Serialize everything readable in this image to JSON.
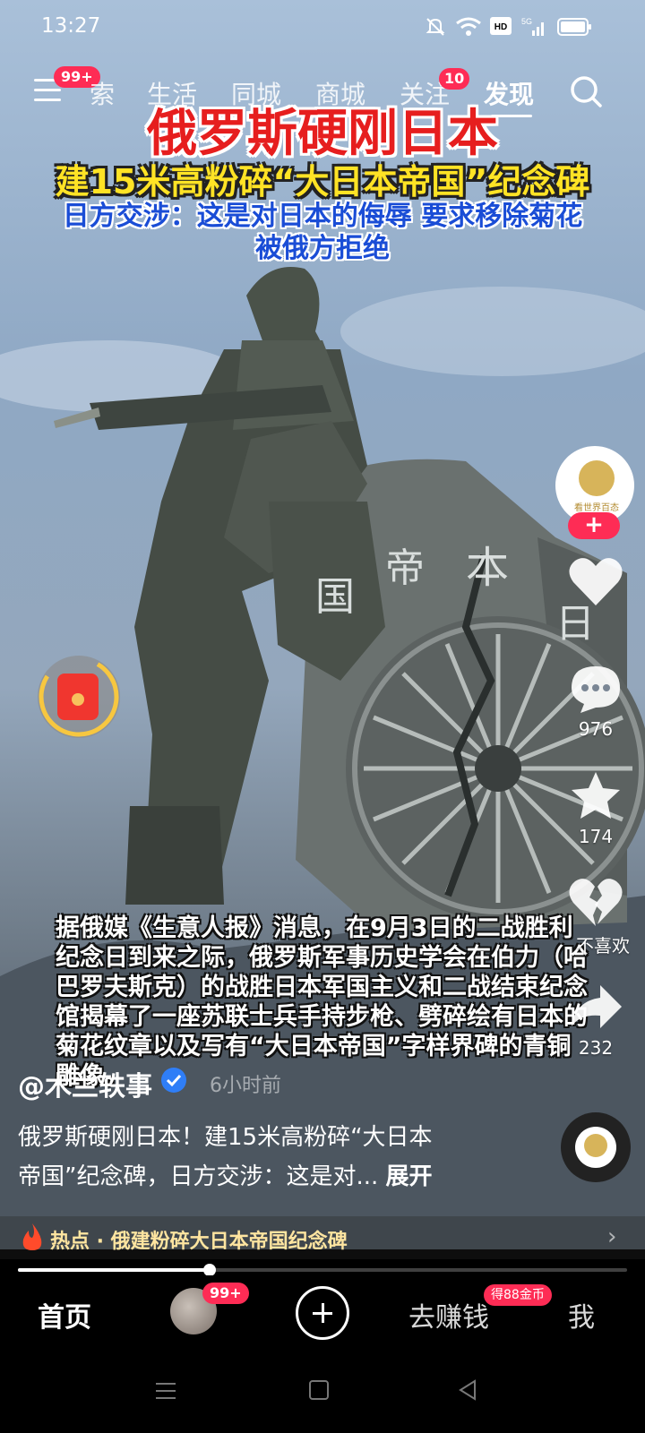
{
  "status_bar": {
    "time": "13:27",
    "network": "5G",
    "hd": "HD"
  },
  "top_nav": {
    "menu_badge": "99+",
    "tabs": [
      "搜索",
      "生活",
      "同城",
      "商城",
      "关注",
      "发现"
    ],
    "tab_visible_0": "索",
    "follow_badge": "10",
    "active_tab": "发现"
  },
  "video_overlay": {
    "line1": "俄罗斯硬刚日本",
    "line2": "建15米高粉碎“大日本帝国”纪念碑",
    "line3a": "日方交涉：这是对日本的侮辱 要求移除菊花",
    "line3b": "被俄方拒绝",
    "caption": "据俄媒《生意人报》消息，在9月3日的二战胜利纪念日到来之际，俄罗斯军事历史学会在伯力（哈巴罗夫斯克）的战胜日本军国主义和二战结束纪念馆揭幕了一座苏联士兵手持步枪、劈碎绘有日本的菊花纹章以及写有“大日本帝国”字样界碑的青铜雕像。"
  },
  "monument_text": [
    "国",
    "帝",
    "本",
    "日"
  ],
  "actions": {
    "like_label": "",
    "comment_count": "976",
    "favorite_count": "174",
    "dislike_label": "不喜欢",
    "share_count": "232",
    "follow_symbol": "+"
  },
  "author": {
    "name": "@木兰轶事",
    "time": "6小时前",
    "avatar_text": "看世界百态"
  },
  "description": {
    "text": "俄罗斯硬刚日本！建15米高粉碎“大日本帝国”纪念碑，日方交涉：这是对...",
    "line1": "俄罗斯硬刚日本！建15米高粉碎“大日本",
    "line2": "帝国”纪念碑，日方交涉：这是对...",
    "expand": "展开"
  },
  "hot_topic": {
    "text": "热点 · 俄建粉碎大日本帝国纪念碑"
  },
  "progress": {
    "fraction": 0.315
  },
  "bottom_nav": {
    "home": "首页",
    "friends_badge": "99+",
    "earn": "去赚钱",
    "earn_badge": "得88金币",
    "me": "我"
  },
  "colors": {
    "accent": "#fe2c55",
    "overlay_red": "#e61e1e",
    "overlay_yellow": "#ffe325",
    "overlay_blue": "#1a4dd6"
  }
}
